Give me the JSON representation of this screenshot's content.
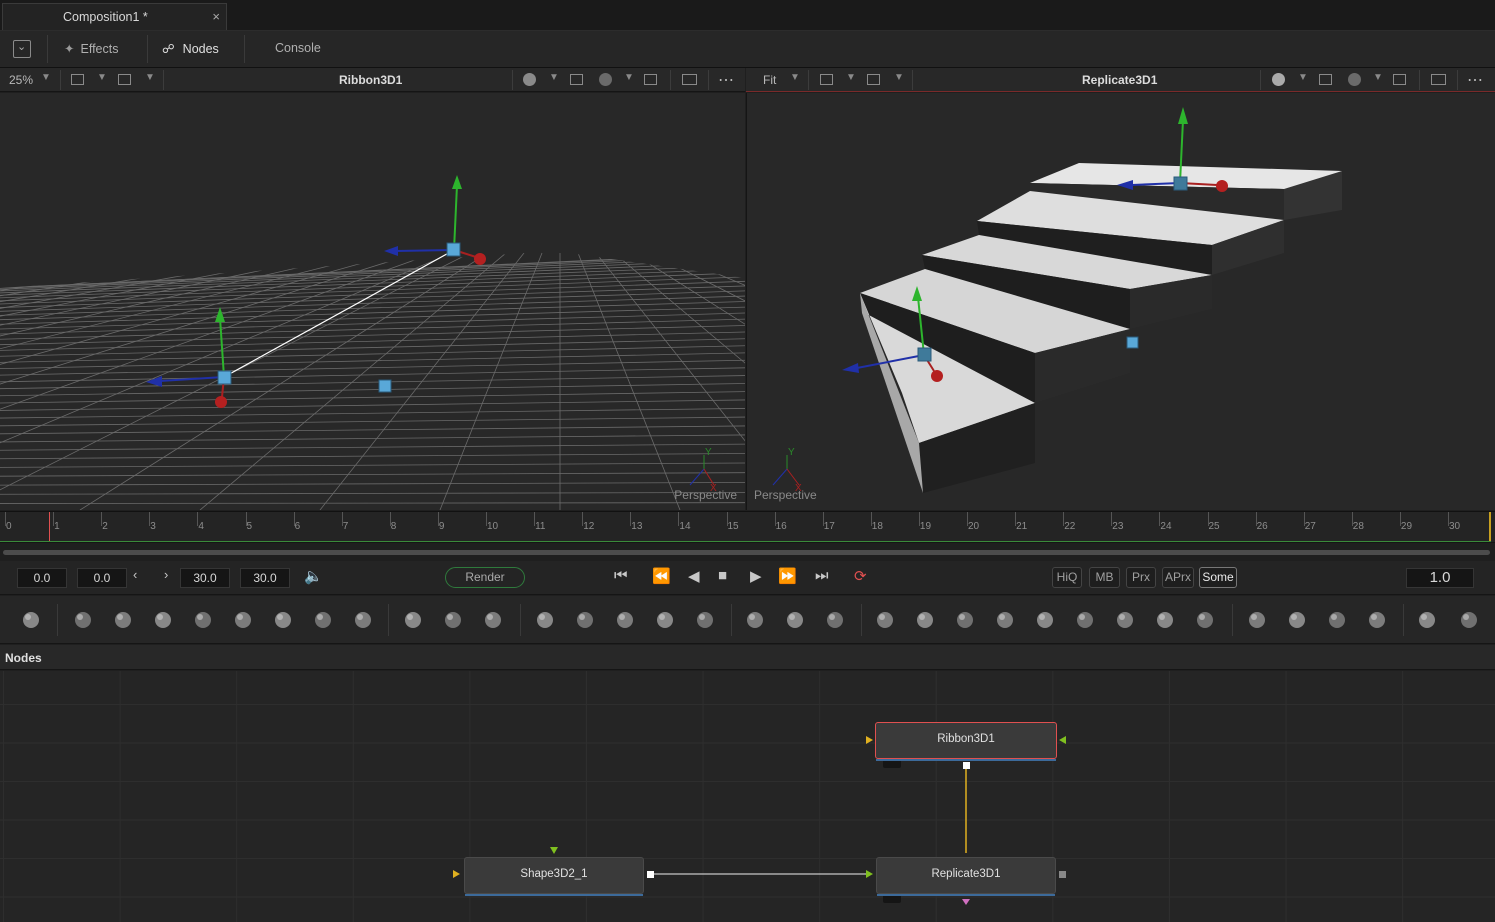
{
  "tab": {
    "title": "Composition1 *",
    "close": "×"
  },
  "toolbar": {
    "effects": "Effects",
    "nodes": "Nodes",
    "console": "Console"
  },
  "left_viewer": {
    "zoom": "25%",
    "title": "Ribbon3D1",
    "label": "Perspective",
    "axis_y": "Y",
    "axis_x": "X"
  },
  "right_viewer": {
    "zoom": "Fit",
    "title": "Replicate3D1",
    "label": "Perspective",
    "axis_y": "Y",
    "axis_x": "X"
  },
  "timeline": {
    "ticks": [
      "0",
      "1",
      "2",
      "3",
      "4",
      "5",
      "6",
      "7",
      "8",
      "9",
      "10",
      "11",
      "12",
      "13",
      "14",
      "15",
      "16",
      "17",
      "18",
      "19",
      "20",
      "21",
      "22",
      "23",
      "24",
      "25",
      "26",
      "27",
      "28",
      "29",
      "30"
    ]
  },
  "transport": {
    "global_start": "0.0",
    "render_start": "0.0",
    "render_end": "30.0",
    "global_end": "30.0",
    "render_label": "Render",
    "current_time": "1.0",
    "options": [
      "HiQ",
      "MB",
      "Prx",
      "APrx",
      "Some"
    ]
  },
  "nodes_panel": {
    "title": "Nodes"
  },
  "nodes": {
    "ribbon": "Ribbon3D1",
    "shape": "Shape3D2_1",
    "replicate": "Replicate3D1"
  },
  "colors": {
    "accent_red": "#e05050",
    "link_yellow": "#e0b020",
    "render_green": "#2f7a3c",
    "node_underline": "#3c6a9a"
  }
}
